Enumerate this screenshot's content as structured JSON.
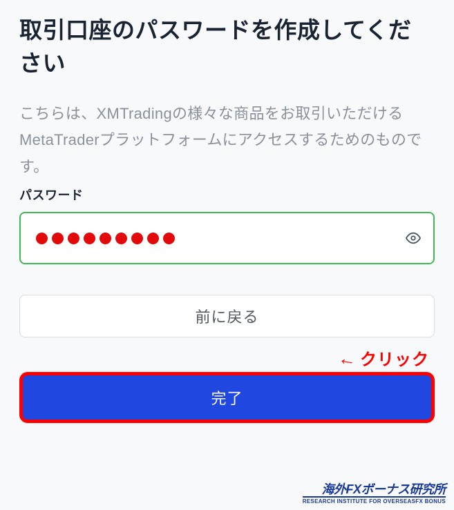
{
  "heading": "取引口座のパスワードを作成してください",
  "description": "こちらは、XMTradingの様々な商品をお取引いただけるMetaTraderプラットフォームにアクセスするためのものです。",
  "field": {
    "label": "パスワード",
    "dot_count": 9
  },
  "buttons": {
    "back_label": "前に戻る",
    "complete_label": "完了"
  },
  "annotation": {
    "text": "クリック"
  },
  "footer": {
    "logo_main": "海外FXボーナス研究所",
    "logo_sub": "RESEARCH INSTITUTE FOR OVERSEASFX BONUS"
  }
}
